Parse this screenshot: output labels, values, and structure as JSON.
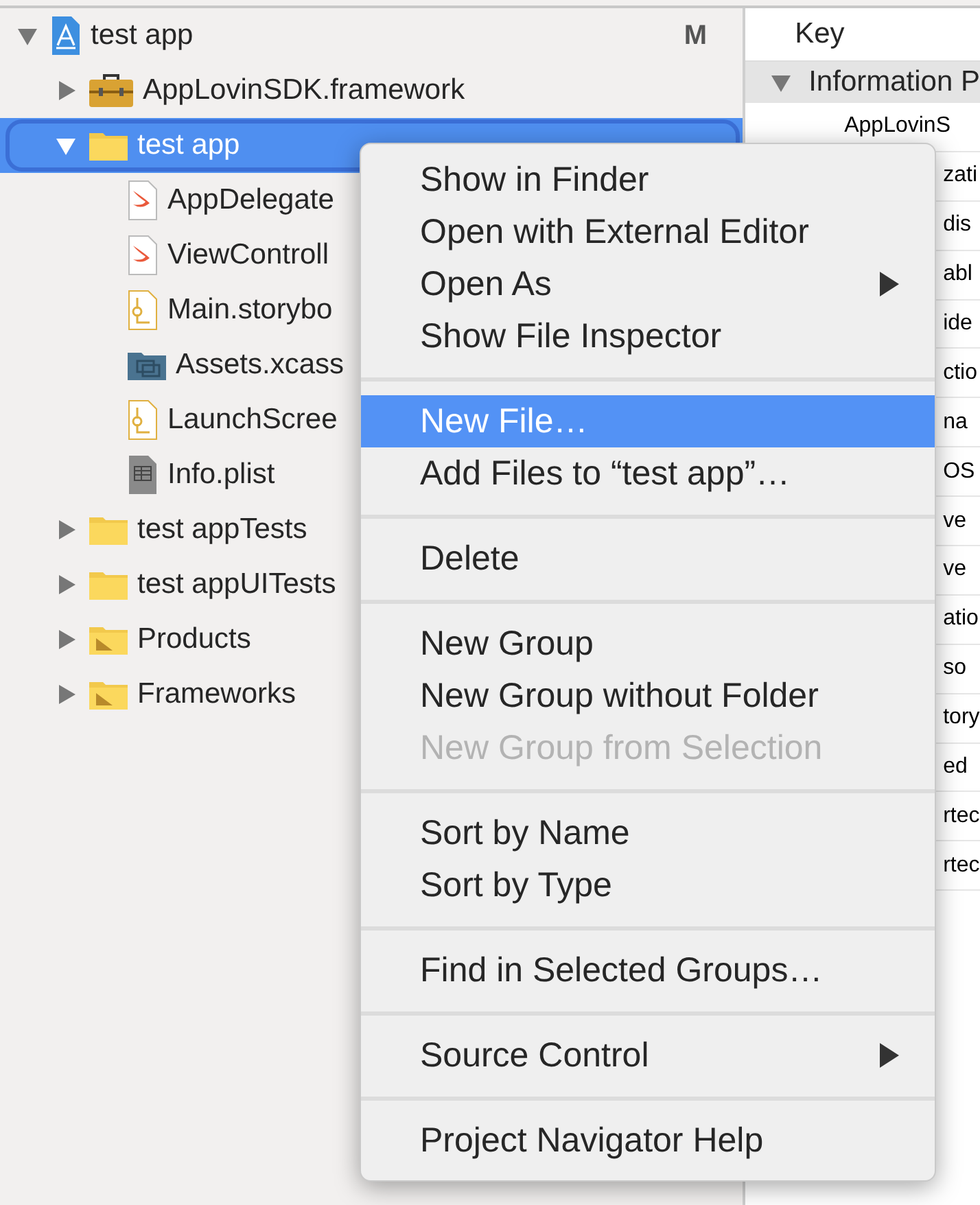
{
  "navigator": {
    "items": [
      {
        "label": "test app",
        "kind": "project",
        "badge": "M",
        "expanded": true,
        "selected": false,
        "children": [
          {
            "label": "AppLovinSDK.framework",
            "kind": "framework",
            "expanded": false,
            "selected": false
          },
          {
            "label": "test app",
            "kind": "folder",
            "expanded": true,
            "selected": true,
            "children": [
              {
                "label": "AppDelegate",
                "kind": "swift",
                "selected": false
              },
              {
                "label": "ViewControll",
                "kind": "swift",
                "selected": false
              },
              {
                "label": "Main.storybo",
                "kind": "storyboard",
                "selected": false
              },
              {
                "label": "Assets.xcass",
                "kind": "assets",
                "selected": false
              },
              {
                "label": "LaunchScree",
                "kind": "storyboard",
                "selected": false
              },
              {
                "label": "Info.plist",
                "kind": "plist",
                "selected": false
              }
            ]
          },
          {
            "label": "test appTests",
            "kind": "folder",
            "expanded": false,
            "selected": false
          },
          {
            "label": "test appUITests",
            "kind": "folder",
            "expanded": false,
            "selected": false
          },
          {
            "label": "Products",
            "kind": "group",
            "expanded": false,
            "selected": false
          },
          {
            "label": "Frameworks",
            "kind": "group",
            "expanded": false,
            "selected": false
          }
        ]
      }
    ]
  },
  "plist": {
    "column_header": "Key",
    "section": {
      "label": "Information P",
      "expanded": true
    },
    "rows": [
      "AppLovinS",
      "zati",
      "dis",
      "abl",
      "ide",
      "ctio",
      "na",
      "OS",
      "ve",
      "ve",
      "atio",
      "so",
      "tory",
      "ed",
      "rtec",
      "rtec"
    ]
  },
  "context_menu": {
    "items": [
      {
        "kind": "item",
        "label": "Show in Finder",
        "selected": false,
        "disabled": false,
        "submenu": false
      },
      {
        "kind": "item",
        "label": "Open with External Editor",
        "selected": false,
        "disabled": false,
        "submenu": false
      },
      {
        "kind": "item",
        "label": "Open As",
        "selected": false,
        "disabled": false,
        "submenu": true
      },
      {
        "kind": "item",
        "label": "Show File Inspector",
        "selected": false,
        "disabled": false,
        "submenu": false
      },
      {
        "kind": "separator"
      },
      {
        "kind": "item",
        "label": "New File…",
        "selected": true,
        "disabled": false,
        "submenu": false
      },
      {
        "kind": "item",
        "label": "Add Files to “test app”…",
        "selected": false,
        "disabled": false,
        "submenu": false
      },
      {
        "kind": "separator"
      },
      {
        "kind": "item",
        "label": "Delete",
        "selected": false,
        "disabled": false,
        "submenu": false
      },
      {
        "kind": "separator"
      },
      {
        "kind": "item",
        "label": "New Group",
        "selected": false,
        "disabled": false,
        "submenu": false
      },
      {
        "kind": "item",
        "label": "New Group without Folder",
        "selected": false,
        "disabled": false,
        "submenu": false
      },
      {
        "kind": "item",
        "label": "New Group from Selection",
        "selected": false,
        "disabled": true,
        "submenu": false
      },
      {
        "kind": "separator"
      },
      {
        "kind": "item",
        "label": "Sort by Name",
        "selected": false,
        "disabled": false,
        "submenu": false
      },
      {
        "kind": "item",
        "label": "Sort by Type",
        "selected": false,
        "disabled": false,
        "submenu": false
      },
      {
        "kind": "separator"
      },
      {
        "kind": "item",
        "label": "Find in Selected Groups…",
        "selected": false,
        "disabled": false,
        "submenu": false
      },
      {
        "kind": "separator"
      },
      {
        "kind": "item",
        "label": "Source Control",
        "selected": false,
        "disabled": false,
        "submenu": true
      },
      {
        "kind": "separator"
      },
      {
        "kind": "item",
        "label": "Project Navigator Help",
        "selected": false,
        "disabled": false,
        "submenu": false
      }
    ]
  }
}
